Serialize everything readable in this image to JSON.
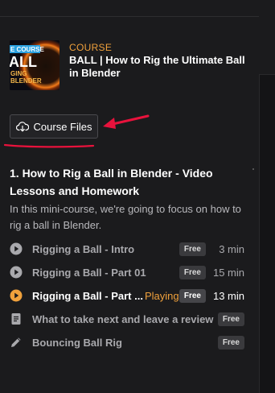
{
  "course": {
    "tag": "COURSE",
    "title": "BALL | How to Rig the Ultimate Ball in Blender",
    "thumbnail": {
      "line1": "E COURSE",
      "line2": "ALL",
      "line3": "GING",
      "line4": "BLENDER"
    }
  },
  "files_button": {
    "label": "Course Files",
    "icon": "cloud-download-icon"
  },
  "section": {
    "title": "1. How to Rig a Ball in Blender - Video Lessons and Homework",
    "description": "In this mini-course, we're going to focus on how to rig a ball in Blender."
  },
  "lessons": [
    {
      "title": "Rigging a Ball - Intro",
      "badge": "Free",
      "duration": "3 min",
      "icon": "play-circle-icon"
    },
    {
      "title": "Rigging a Ball - Part 01",
      "badge": "Free",
      "duration": "15 min",
      "icon": "play-circle-icon"
    },
    {
      "title": "Rigging a Ball - Part ...",
      "status": "Playing",
      "badge": "Free",
      "duration": "13 min",
      "icon": "play-circle-icon"
    },
    {
      "title": "What to take next and leave a review",
      "badge": "Free",
      "icon": "document-icon"
    },
    {
      "title": "Bouncing Ball Rig",
      "badge": "Free",
      "icon": "pencil-icon"
    }
  ],
  "colors": {
    "accent": "#f0a13c",
    "annotation": "#e8123c",
    "background": "#1b1b1d"
  }
}
